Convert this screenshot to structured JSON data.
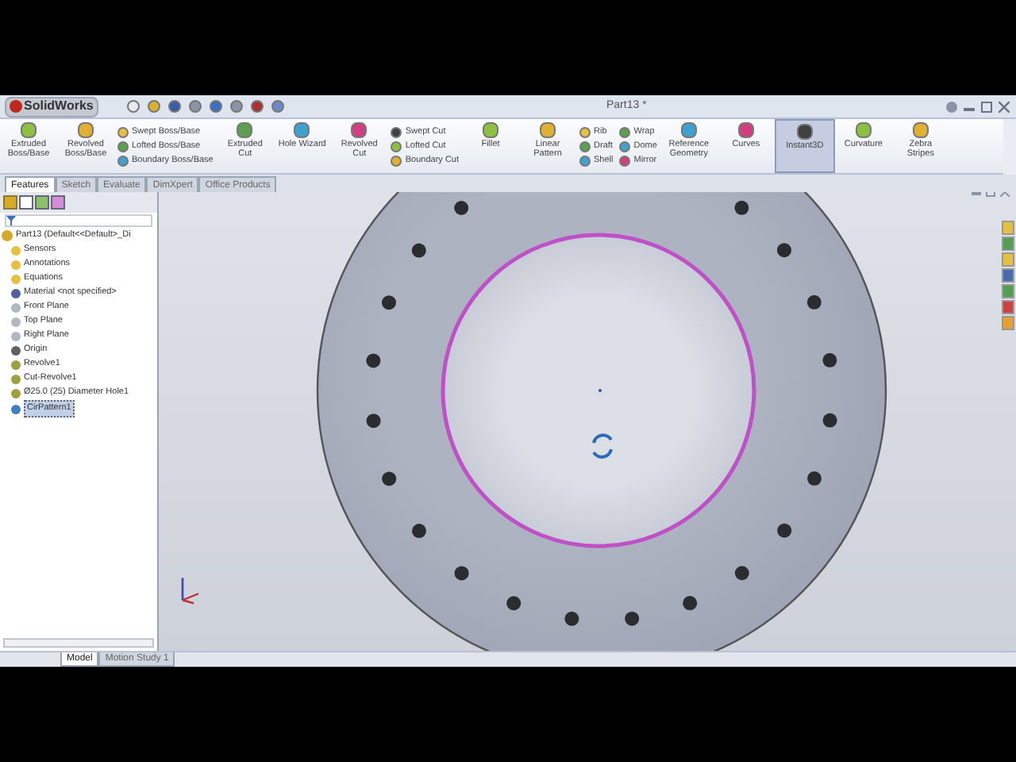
{
  "title_bar": {
    "app": "SolidWorks",
    "document": "Part13 *"
  },
  "ribbon": [
    {
      "kind": "large",
      "label": "Extruded Boss/Base",
      "selected": false
    },
    {
      "kind": "large",
      "label": "Revolved Boss/Base",
      "selected": false
    },
    {
      "kind": "stack",
      "items": [
        "Swept Boss/Base",
        "Lofted Boss/Base",
        "Boundary Boss/Base"
      ]
    },
    {
      "kind": "large",
      "label": "Extruded Cut",
      "selected": false
    },
    {
      "kind": "large",
      "label": "Hole Wizard",
      "selected": false
    },
    {
      "kind": "large",
      "label": "Revolved Cut",
      "selected": false
    },
    {
      "kind": "stack",
      "items": [
        "Swept Cut",
        "Lofted Cut",
        "Boundary Cut"
      ]
    },
    {
      "kind": "large",
      "label": "Fillet",
      "selected": false
    },
    {
      "kind": "large",
      "label": "Linear Pattern",
      "selected": false
    },
    {
      "kind": "stack",
      "items": [
        "Rib",
        "Draft",
        "Shell"
      ]
    },
    {
      "kind": "stack",
      "items": [
        "Wrap",
        "Dome",
        "Mirror"
      ]
    },
    {
      "kind": "large",
      "label": "Reference Geometry",
      "selected": false
    },
    {
      "kind": "large",
      "label": "Curves",
      "selected": false
    },
    {
      "kind": "large",
      "label": "Instant3D",
      "selected": true
    },
    {
      "kind": "large",
      "label": "Curvature",
      "selected": false
    },
    {
      "kind": "large",
      "label": "Zebra Stripes",
      "selected": false
    }
  ],
  "tabs": [
    {
      "label": "Features",
      "selected": true
    },
    {
      "label": "Sketch",
      "selected": false
    },
    {
      "label": "Evaluate",
      "selected": false
    },
    {
      "label": "DimXpert",
      "selected": false
    },
    {
      "label": "Office Products",
      "selected": false
    }
  ],
  "tree": {
    "label": "Part13 (Default<<Default>_Di",
    "children": [
      {
        "label": "Sensors",
        "selected": false
      },
      {
        "label": "Annotations",
        "selected": false
      },
      {
        "label": "Equations",
        "selected": false
      },
      {
        "label": "Material <not specified>",
        "selected": false
      },
      {
        "label": "Front Plane",
        "selected": false
      },
      {
        "label": "Top Plane",
        "selected": false
      },
      {
        "label": "Right Plane",
        "selected": false
      },
      {
        "label": "Origin",
        "selected": false
      },
      {
        "label": "Revolve1",
        "selected": false
      },
      {
        "label": "Cut-Revolve1",
        "selected": false
      },
      {
        "label": "Ø25.0 (25) Diameter Hole1",
        "selected": false
      },
      {
        "label": "CirPattern1",
        "selected": true
      }
    ]
  },
  "bottom_tabs": [
    {
      "label": "Model",
      "selected": true
    },
    {
      "label": "Motion Study 1",
      "selected": false
    }
  ]
}
